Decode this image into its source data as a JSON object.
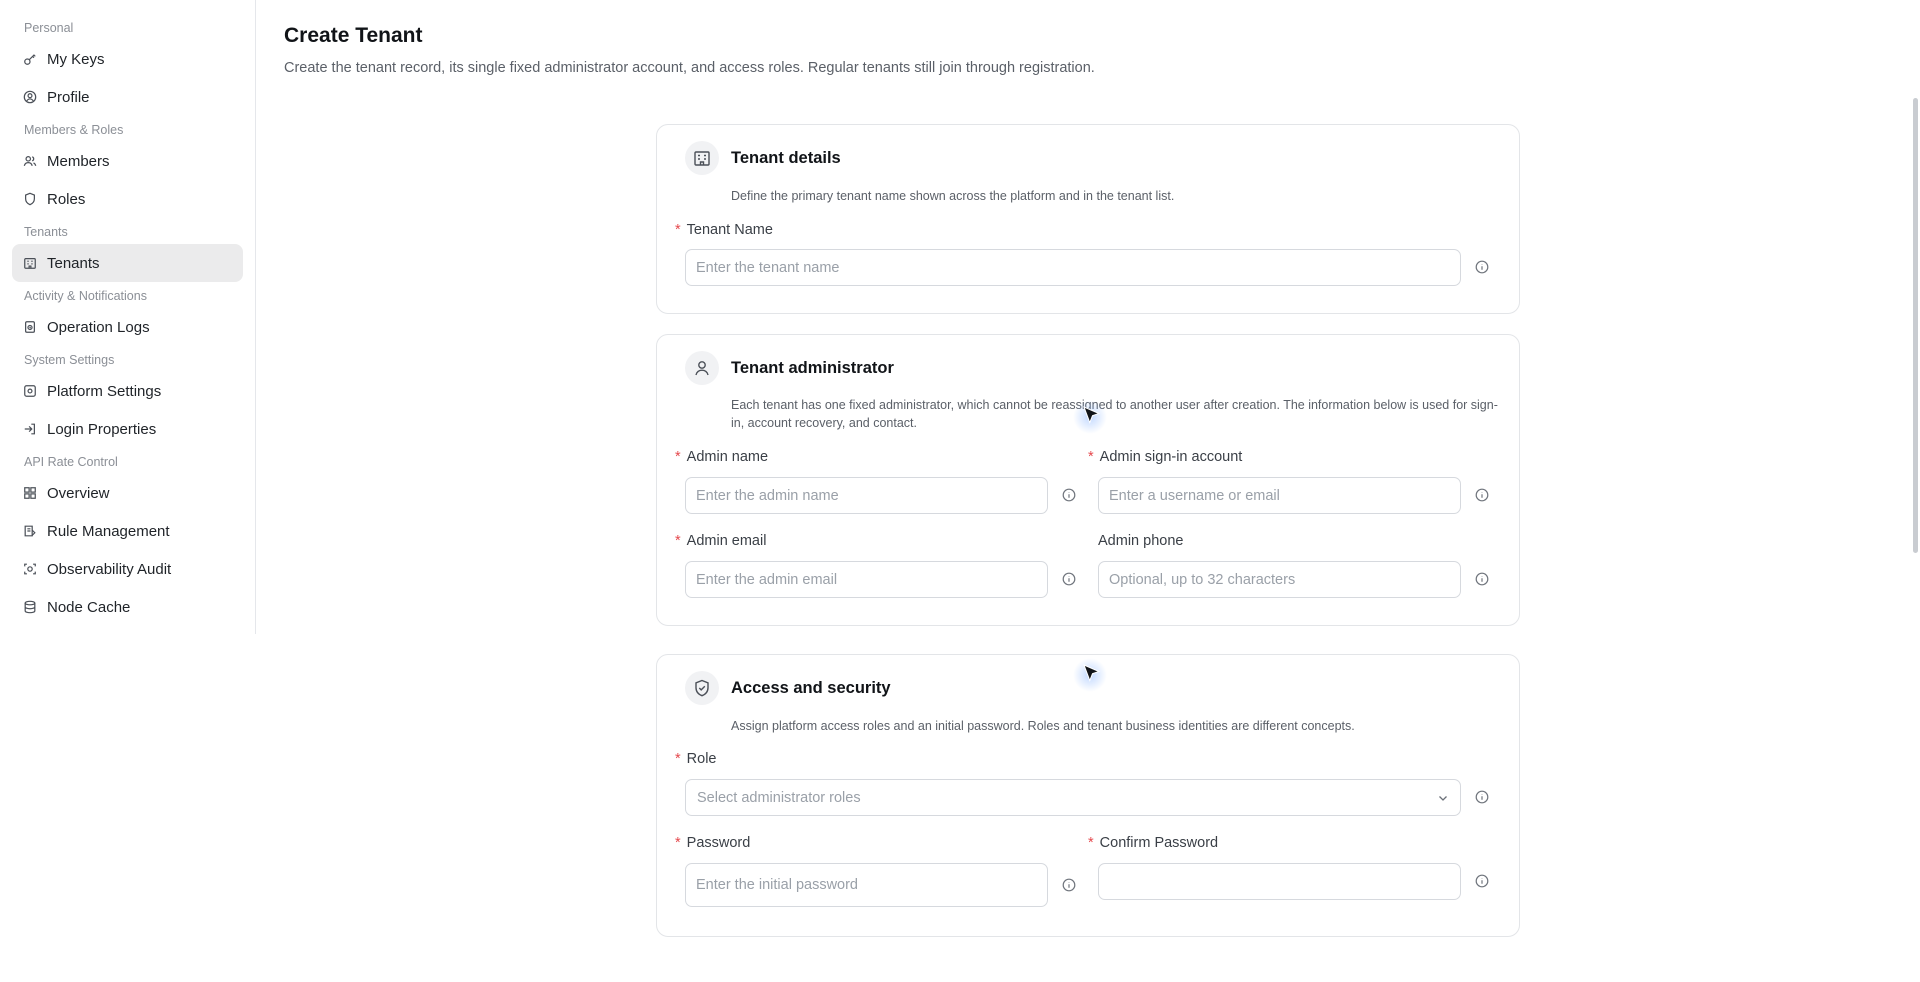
{
  "sidebar": {
    "groups": [
      {
        "label": "Personal",
        "items": [
          {
            "label": "My Keys",
            "icon": "key-icon"
          },
          {
            "label": "Profile",
            "icon": "user-circle-icon"
          }
        ]
      },
      {
        "label": "Members & Roles",
        "items": [
          {
            "label": "Members",
            "icon": "users-icon"
          },
          {
            "label": "Roles",
            "icon": "shield-icon"
          }
        ]
      },
      {
        "label": "Tenants",
        "items": [
          {
            "label": "Tenants",
            "icon": "building-icon",
            "active": true
          }
        ]
      },
      {
        "label": "Activity & Notifications",
        "items": [
          {
            "label": "Operation Logs",
            "icon": "log-icon"
          }
        ]
      },
      {
        "label": "System Settings",
        "items": [
          {
            "label": "Platform Settings",
            "icon": "settings-icon"
          },
          {
            "label": "Login Properties",
            "icon": "login-icon"
          }
        ]
      },
      {
        "label": "API Rate Control",
        "items": [
          {
            "label": "Overview",
            "icon": "grid-icon"
          },
          {
            "label": "Rule Management",
            "icon": "rules-icon"
          },
          {
            "label": "Observability Audit",
            "icon": "audit-icon"
          },
          {
            "label": "Node Cache",
            "icon": "database-icon"
          }
        ]
      }
    ]
  },
  "header": {
    "title": "Create Tenant",
    "subtitle": "Create the tenant record, its single fixed administrator account, and access roles. Regular tenants still join through registration."
  },
  "details": {
    "title": "Tenant details",
    "description": "Define the primary tenant name shown across the platform and in the tenant list.",
    "tenant_name_label": "Tenant Name",
    "tenant_name_placeholder": "Enter the tenant name"
  },
  "admin": {
    "title": "Tenant administrator",
    "description": "Each tenant has one fixed administrator, which cannot be reassigned to another user after creation. The information below is used for sign-in, account recovery, and contact.",
    "name_label": "Admin name",
    "name_placeholder": "Enter the admin name",
    "account_label": "Admin sign-in account",
    "account_placeholder": "Enter a username or email",
    "email_label": "Admin email",
    "email_placeholder": "Enter the admin email",
    "phone_label": "Admin phone",
    "phone_placeholder": "Optional, up to 32 characters"
  },
  "access": {
    "title": "Access and security",
    "description": "Assign platform access roles and an initial password. Roles and tenant business identities are different concepts.",
    "role_label": "Role",
    "role_placeholder": "Select administrator roles",
    "password_label": "Password",
    "password_placeholder": "Enter the initial password",
    "confirm_label": "Confirm Password",
    "confirm_placeholder": ""
  },
  "required_mark": "*"
}
